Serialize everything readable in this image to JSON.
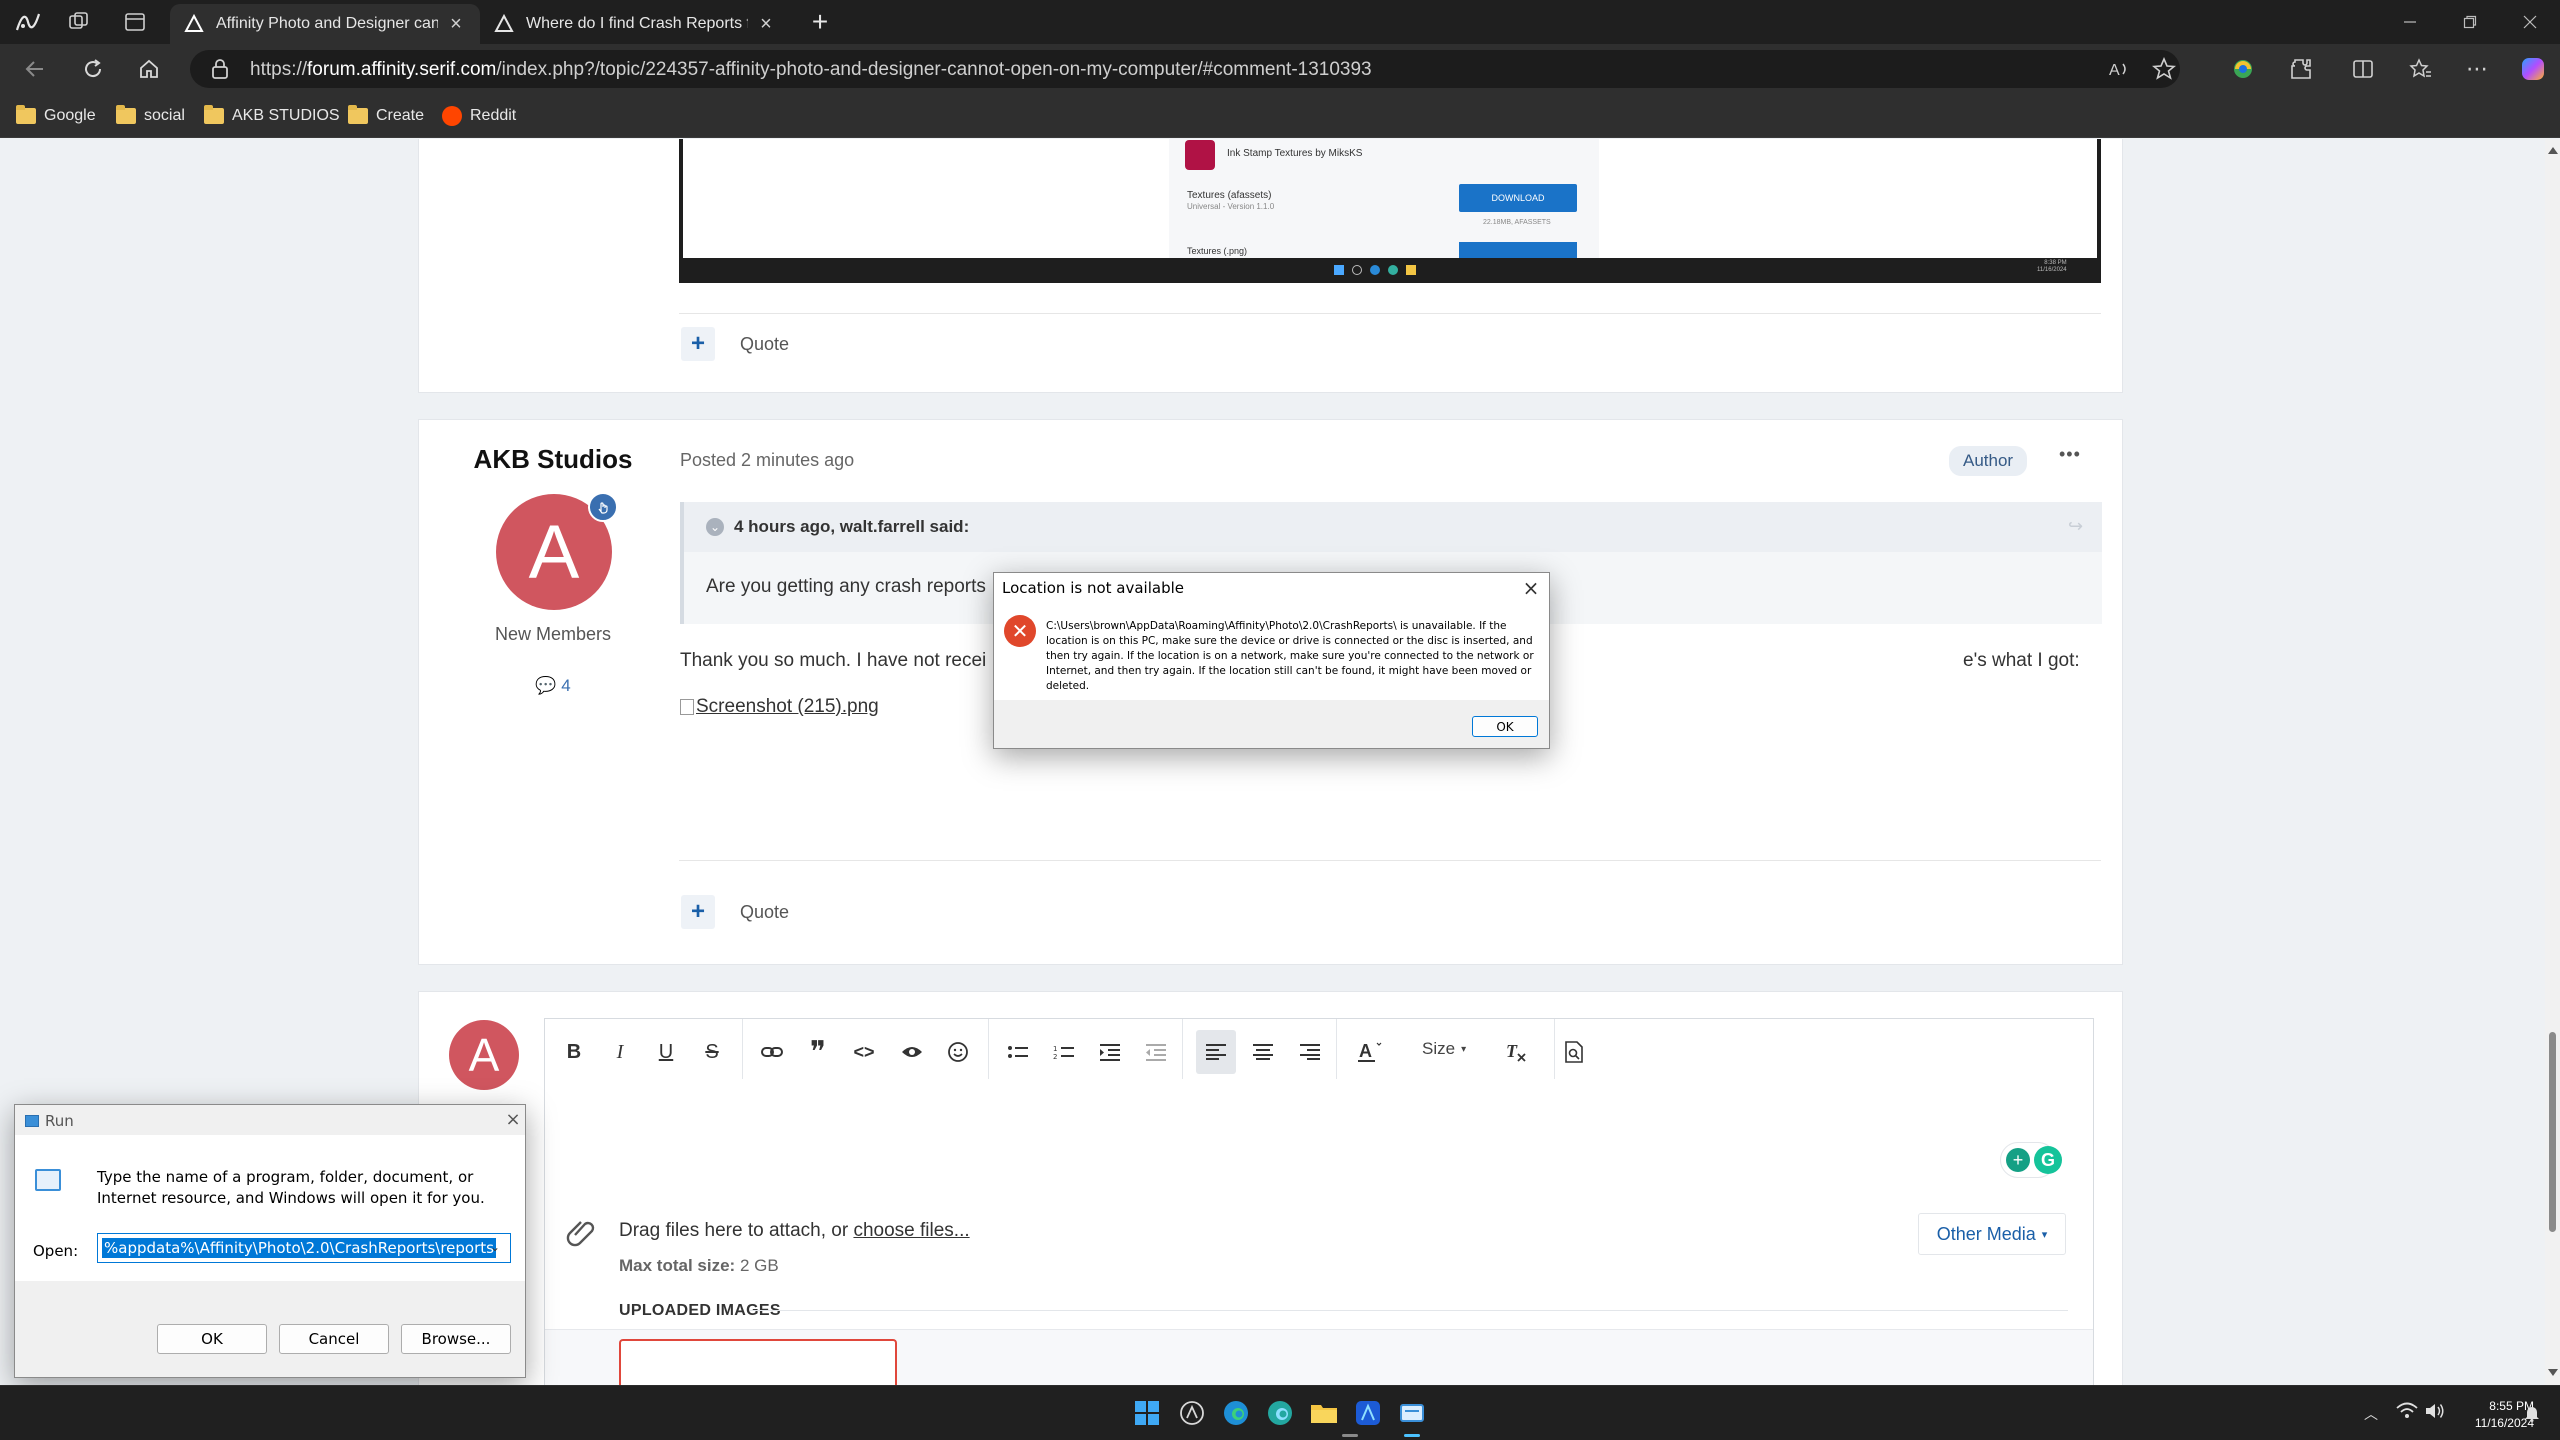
{
  "browser": {
    "tabs": [
      {
        "title": "Affinity Photo and Designer cann",
        "active": true
      },
      {
        "title": "Where do I find Crash Reports fo",
        "active": false
      }
    ],
    "url_prefix": "https://",
    "url_host": "forum.affinity.serif.com",
    "url_path": "/index.php?/topic/224357-affinity-photo-and-designer-cannot-open-on-my-computer/#comment-1310393",
    "bookmarks": [
      "Google",
      "social",
      "AKB STUDIOS",
      "Create",
      "Reddit"
    ]
  },
  "screenshot_embed": {
    "title": "Ink Stamp Textures by MiksKS",
    "item_name": "Textures (afassets)",
    "item_sub": "Universal - Version 1.1.0",
    "download_label": "DOWNLOAD",
    "size_text": "22.18MB, AFASSETS",
    "next_item": "Textures (.png)",
    "clock_time": "8:38 PM",
    "clock_date": "11/16/2024"
  },
  "post1": {
    "plus": "+",
    "quote": "Quote"
  },
  "post2": {
    "author": "AKB Studios",
    "avatar_letter": "A",
    "member_group": "New Members",
    "post_count": "4",
    "posted_prefix": "Posted ",
    "posted_time": "2 minutes ago",
    "author_badge": "Author",
    "more": "•••",
    "quote_header": "4 hours ago, walt.farrell said:",
    "quote_body": "Are you getting any crash reports",
    "body_start": "Thank you so much. I have not recei",
    "body_end": "e's what I got:",
    "image_alt": "Screenshot (215).png",
    "plus": "+",
    "quote": "Quote"
  },
  "editor": {
    "avatar_letter": "A",
    "size_label": "Size",
    "drag_text": "Drag files here to attach, or",
    "choose_files": "choose files...",
    "max_label": "Max total size:",
    "max_value": "2 GB",
    "other_media": "Other Media",
    "uploaded_header": "UPLOADED IMAGES"
  },
  "location_dialog": {
    "title": "Location is not available",
    "message": "C:\\Users\\brown\\AppData\\Roaming\\Affinity\\Photo\\2.0\\CrashReports\\ is unavailable. If the location is on this PC, make sure the device or drive is connected or the disc is inserted, and then try again. If the location is on a network, make sure you're connected to the network or Internet, and then try again. If the location still can't be found, it might have been moved or deleted.",
    "ok": "OK"
  },
  "run_dialog": {
    "title": "Run",
    "description": "Type the name of a program, folder, document, or Internet resource, and Windows will open it for you.",
    "open_label": "Open:",
    "open_value": "%appdata%\\Affinity\\Photo\\2.0\\CrashReports\\reports",
    "ok": "OK",
    "cancel": "Cancel",
    "browse": "Browse..."
  },
  "taskbar": {
    "time": "8:55 PM",
    "date": "11/16/2024"
  },
  "colors": {
    "accent": "#1a73c8",
    "avatar": "#d0565f",
    "error": "#e0472b"
  }
}
